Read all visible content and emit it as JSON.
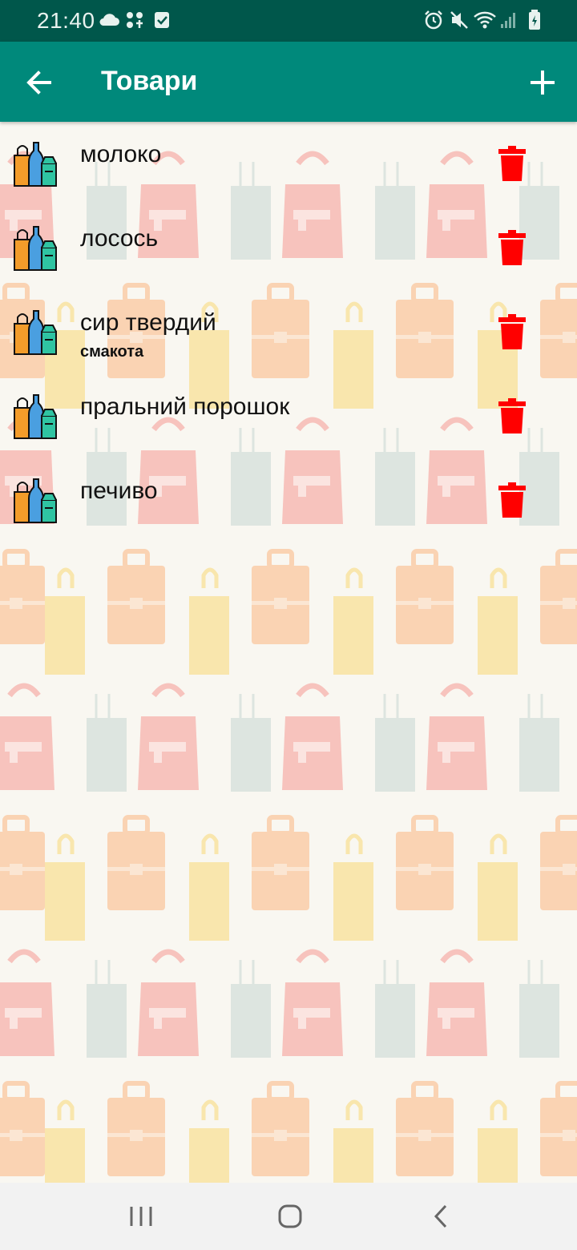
{
  "status_bar": {
    "time": "21:40",
    "left_icons": [
      "cloud-icon",
      "apps-sync-icon",
      "checkbox-icon"
    ],
    "right_icons": [
      "alarm-icon",
      "mute-icon",
      "wifi-icon",
      "signal-icon",
      "battery-charging-icon"
    ]
  },
  "app_bar": {
    "title": "Товари",
    "back_icon": "arrow-back-icon",
    "add_icon": "plus-icon",
    "color": "#00897b"
  },
  "items": [
    {
      "name": "молоко",
      "subtitle": ""
    },
    {
      "name": "лосось",
      "subtitle": ""
    },
    {
      "name": "сир твердий",
      "subtitle": "смакота"
    },
    {
      "name": "пральний порошок",
      "subtitle": ""
    },
    {
      "name": "печиво",
      "subtitle": ""
    }
  ],
  "item_icon": "grocery-icon",
  "delete_icon": "trash-icon",
  "delete_color": "#ff0000",
  "nav_bar": {
    "buttons": [
      "recent-apps-icon",
      "home-icon",
      "back-icon"
    ]
  }
}
